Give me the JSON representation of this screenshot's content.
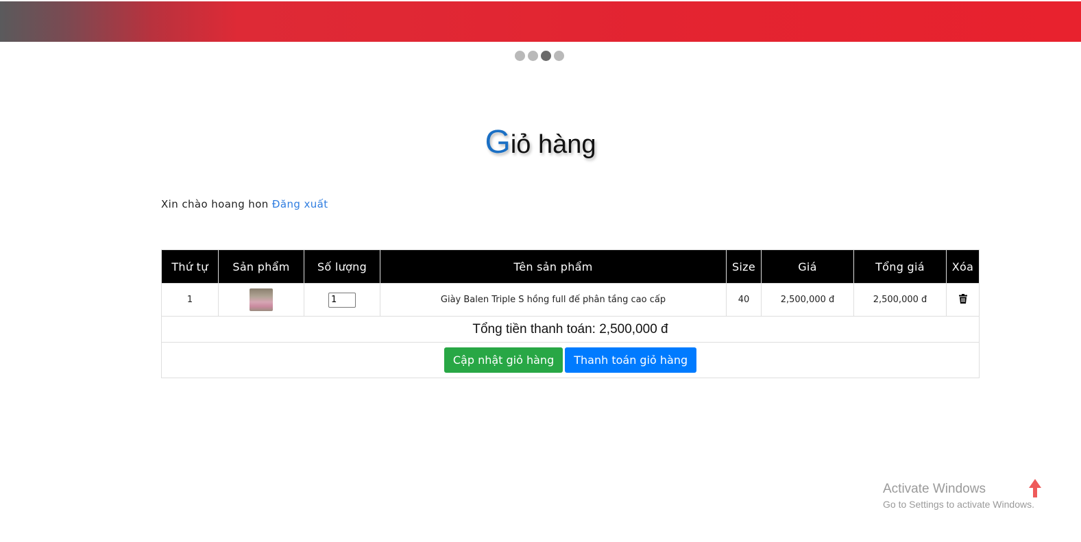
{
  "carousel": {
    "dot_count": 4,
    "active_index": 2
  },
  "page": {
    "title_first": "G",
    "title_rest": "iỏ hàng"
  },
  "greeting": {
    "text": "Xin chào hoang hon",
    "logout_label": "Đăng xuất"
  },
  "cart": {
    "headers": [
      "Thứ tự",
      "Sản phẩm",
      "Số lượng",
      "Tên sản phẩm",
      "Size",
      "Giá",
      "Tổng giá",
      "Xóa"
    ],
    "rows": [
      {
        "index": "1",
        "quantity": "1",
        "name": "Giày Balen Triple S hồng full đế phân tầng cao cấp",
        "size": "40",
        "price": "2,500,000 đ",
        "total": "2,500,000 đ"
      }
    ],
    "grand_total": "Tổng tiền thanh toán: 2,500,000 đ",
    "update_button": "Cập nhật giỏ hàng",
    "checkout_button": "Thanh toán giỏ hàng"
  },
  "watermark": {
    "line1": "Activate Windows",
    "line2": "Go to Settings to activate Windows."
  },
  "colors": {
    "accent": "#1a6fc4",
    "banner_red": "#e32431",
    "green": "#28a745",
    "blue": "#007bff"
  }
}
